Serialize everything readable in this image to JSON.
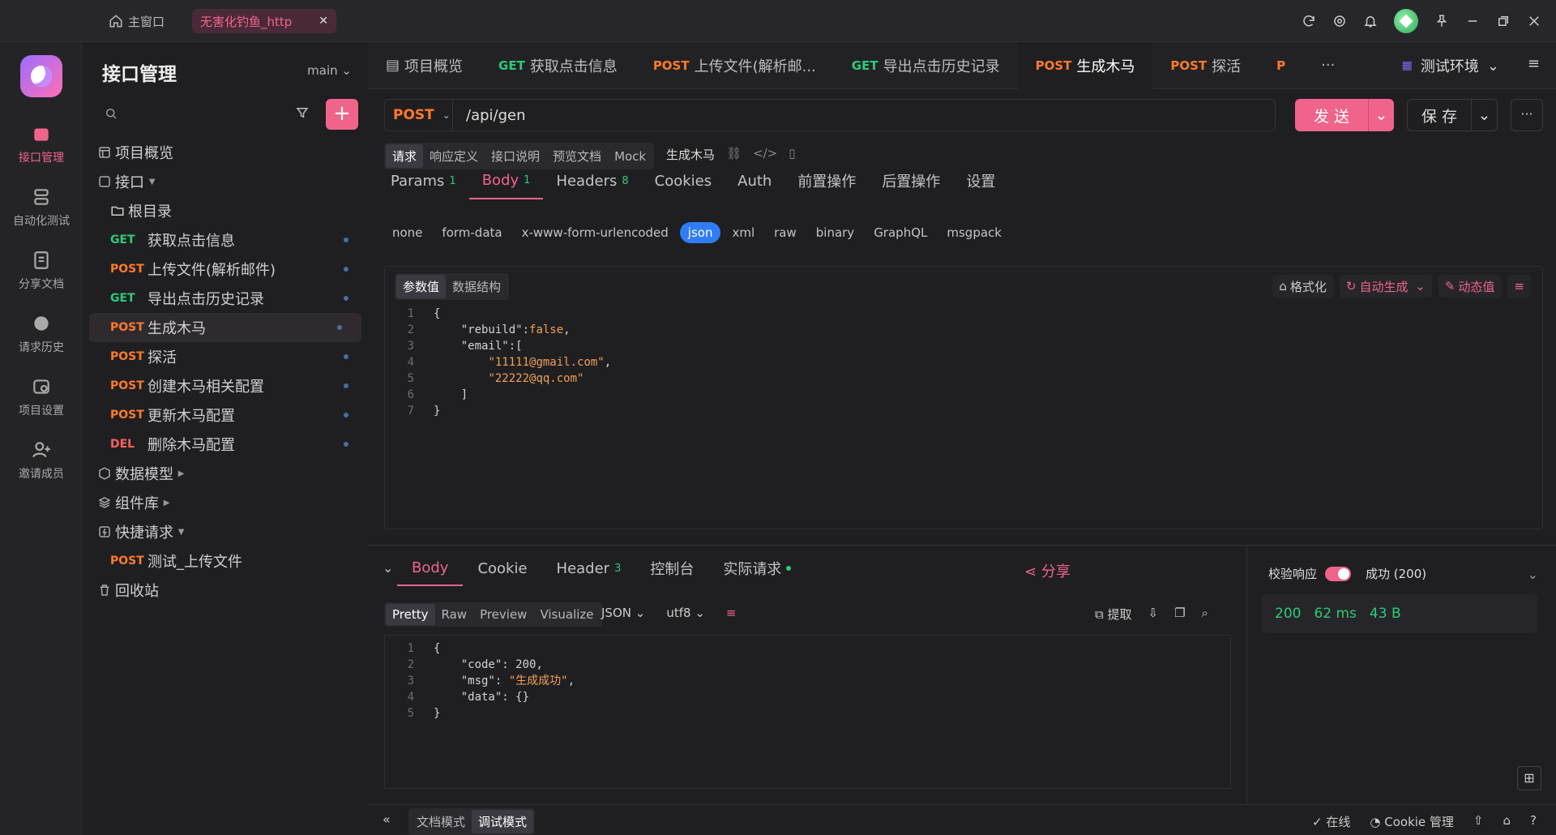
{
  "titlebar": {
    "home": "主窗口",
    "project_tab": "无害化钓鱼_http"
  },
  "rail": [
    {
      "label": "接口管理"
    },
    {
      "label": "自动化测试"
    },
    {
      "label": "分享文档"
    },
    {
      "label": "请求历史"
    },
    {
      "label": "项目设置"
    },
    {
      "label": "邀请成员"
    }
  ],
  "sidebar": {
    "title": "接口管理",
    "branch": "main",
    "overview": "项目概览",
    "api": "接口",
    "root": "根目录",
    "items": [
      {
        "method": "GET",
        "name": "获取点击信息"
      },
      {
        "method": "POST",
        "name": "上传文件(解析邮件)"
      },
      {
        "method": "GET",
        "name": "导出点击历史记录"
      },
      {
        "method": "POST",
        "name": "生成木马"
      },
      {
        "method": "POST",
        "name": "探活"
      },
      {
        "method": "POST",
        "name": "创建木马相关配置"
      },
      {
        "method": "POST",
        "name": "更新木马配置"
      },
      {
        "method": "DEL",
        "name": "删除木马配置"
      }
    ],
    "models": "数据模型",
    "components": "组件库",
    "quick": "快捷请求",
    "quick_item": {
      "method": "POST",
      "name": "测试_上传文件"
    },
    "trash": "回收站"
  },
  "tabs": [
    {
      "method": "",
      "name": "项目概览"
    },
    {
      "method": "GET",
      "name": "获取点击信息"
    },
    {
      "method": "POST",
      "name": "上传文件(解析邮..."
    },
    {
      "method": "GET",
      "name": "导出点击历史记录"
    },
    {
      "method": "POST",
      "name": "生成木马"
    },
    {
      "method": "POST",
      "name": "探活"
    },
    {
      "method": "P",
      "name": ""
    }
  ],
  "env": "测试环境",
  "request": {
    "method": "POST",
    "url": "/api/gen",
    "send": "发 送",
    "save": "保 存",
    "subnav": [
      "请求",
      "响应定义",
      "接口说明",
      "预览文档",
      "Mock"
    ],
    "name": "生成木马",
    "tabs": [
      {
        "label": "Params",
        "count": "1"
      },
      {
        "label": "Body",
        "count": "1"
      },
      {
        "label": "Headers",
        "count": "8"
      },
      {
        "label": "Cookies",
        "count": ""
      },
      {
        "label": "Auth",
        "count": ""
      },
      {
        "label": "前置操作",
        "count": ""
      },
      {
        "label": "后置操作",
        "count": ""
      },
      {
        "label": "设置",
        "count": ""
      }
    ],
    "ctypes": [
      "none",
      "form-data",
      "x-www-form-urlencoded",
      "json",
      "xml",
      "raw",
      "binary",
      "GraphQL",
      "msgpack"
    ],
    "editor_modes": [
      "参数值",
      "数据结构"
    ],
    "tools": [
      "格式化",
      "自动生成",
      "动态值"
    ]
  },
  "response": {
    "tabs": [
      {
        "label": "Body",
        "count": ""
      },
      {
        "label": "Cookie",
        "count": ""
      },
      {
        "label": "Header",
        "count": "3"
      },
      {
        "label": "控制台",
        "count": ""
      },
      {
        "label": "实际请求",
        "count": ""
      }
    ],
    "share": "分享",
    "modes": [
      "Pretty",
      "Raw",
      "Preview",
      "Visualize"
    ],
    "format": "JSON",
    "encoding": "utf8",
    "extract": "提取",
    "check": "校验响应",
    "result": "成功 (200)",
    "status": "200",
    "time": "62 ms",
    "size": "43 B"
  },
  "statusbar": {
    "doc_mode": "文档模式",
    "debug_mode": "调试模式",
    "online": "在线",
    "cookie": "Cookie 管理"
  }
}
